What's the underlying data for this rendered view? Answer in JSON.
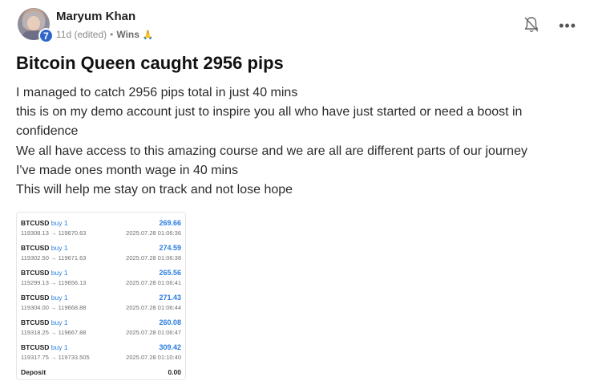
{
  "post": {
    "author": "Maryum Khan",
    "level": "7",
    "time": "11d (edited)",
    "separator": "•",
    "category": "Wins",
    "category_emoji": "🙏",
    "title": "Bitcoin Queen caught 2956 pips",
    "body_lines": [
      "I managed to catch 2956 pips total in just 40 mins",
      "this is on my demo account just to inspire you all who have just started or need a boost in",
      "confidence",
      "We all have access to this amazing course and we are all are different parts of our journey",
      "I've made ones month wage in 40 mins",
      "This will help me stay on track and not lose hope"
    ]
  },
  "actions": {
    "bell_icon": "bell-off-icon",
    "more_label": "•••"
  },
  "trades": [
    {
      "symbol": "BTCUSD",
      "side": "buy 1",
      "prices": "119308.13 → 119670.63",
      "profit": "269.66",
      "time": "2025.07.28 01:06:36"
    },
    {
      "symbol": "BTCUSD",
      "side": "buy 1",
      "prices": "119302.50 → 119671.63",
      "profit": "274.59",
      "time": "2025.07.28 01:06:38"
    },
    {
      "symbol": "BTCUSD",
      "side": "buy 1",
      "prices": "119299.13 → 119656.13",
      "profit": "265.56",
      "time": "2025.07.28 01:06:41"
    },
    {
      "symbol": "BTCUSD",
      "side": "buy 1",
      "prices": "119304.00 → 119668.88",
      "profit": "271.43",
      "time": "2025.07.28 01:06:44"
    },
    {
      "symbol": "BTCUSD",
      "side": "buy 1",
      "prices": "119318.25 → 119667.88",
      "profit": "260.08",
      "time": "2025.07.28 01:06:47"
    },
    {
      "symbol": "BTCUSD",
      "side": "buy 1",
      "prices": "119317.75 → 119733.505",
      "profit": "309.42",
      "time": "2025.07.28 01:10:40"
    }
  ],
  "deposit": {
    "label": "Deposit",
    "value": "0.00"
  },
  "colors": {
    "accent_blue": "#2a7de1",
    "badge_blue": "#2f66c9"
  }
}
